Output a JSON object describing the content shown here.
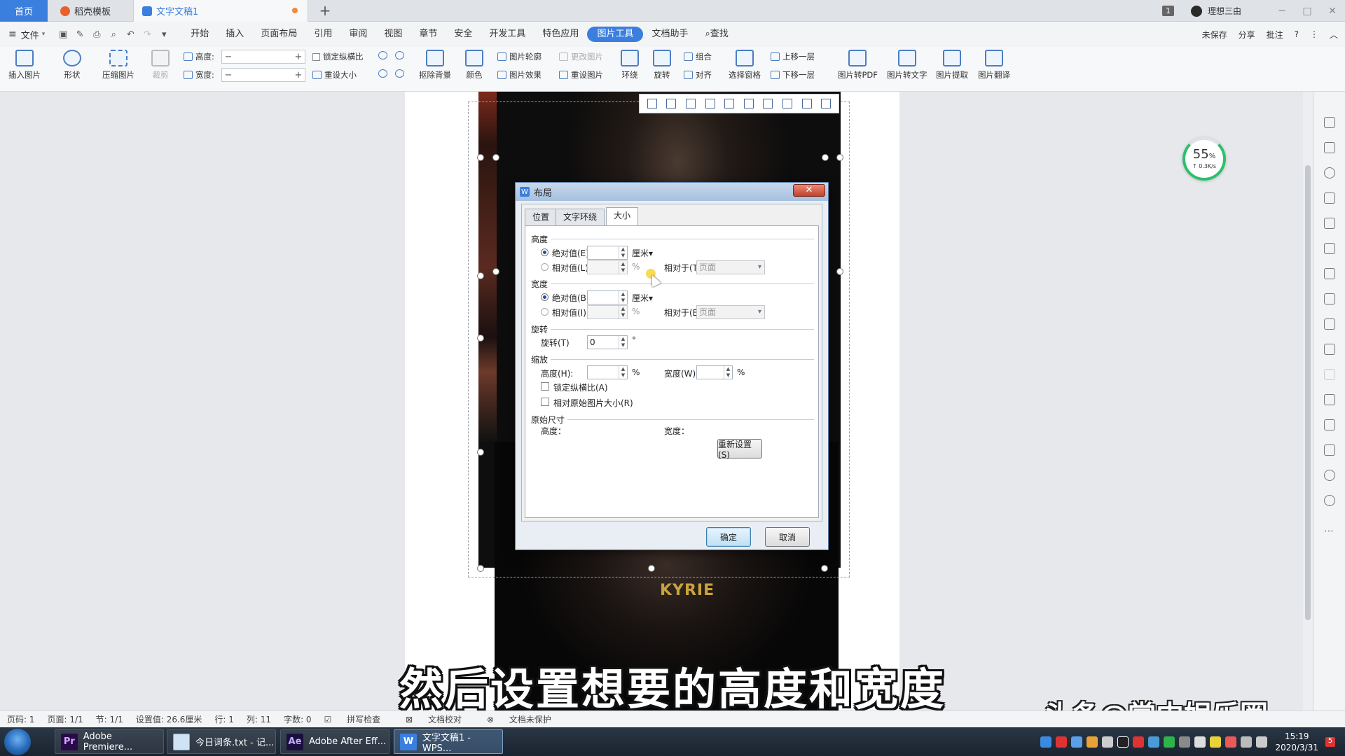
{
  "titlebar": {
    "tabs": [
      "首页",
      "稻壳模板",
      "文字文稿1"
    ],
    "add": "+",
    "badge": "1",
    "user": "理想三由",
    "window_buttons": [
      "─",
      "□",
      "✕"
    ]
  },
  "menubar": {
    "file": "文件",
    "items": [
      "开始",
      "插入",
      "页面布局",
      "引用",
      "审阅",
      "视图",
      "章节",
      "安全",
      "开发工具",
      "特色应用",
      "图片工具",
      "文档助手",
      "查找"
    ],
    "active_index": 10,
    "right": [
      "未保存",
      "分享",
      "批注",
      "?",
      "⋮",
      "︿"
    ]
  },
  "ribbon": {
    "insert_pic": "插入图片",
    "shape": "形状",
    "compress": "压缩图片",
    "crop": "裁剪",
    "height_label": "高度:",
    "width_label": "宽度:",
    "lock_ratio": "锁定纵横比",
    "reset_size": "重设大小",
    "remove_bg": "抠除背景",
    "color": "颜色",
    "pic_outline": "图片轮廓",
    "pic_effect": "图片效果",
    "change_pic": "更改图片",
    "reset_pic": "重设图片",
    "wrap": "环绕",
    "rotate": "旋转",
    "group": "组合",
    "align": "对齐",
    "select_pane": "选择窗格",
    "bring_forward": "上移一层",
    "send_backward": "下移一层",
    "to_pdf": "图片转PDF",
    "to_text": "图片转文字",
    "extract": "图片提取",
    "translate": "图片翻译",
    "minus": "−",
    "plus": "+"
  },
  "gauge": {
    "percent": "55",
    "unit": "%",
    "speed": "↑ 0.3K/s"
  },
  "photo": {
    "shirt_text": "KYRIE"
  },
  "dialog": {
    "title": "布局",
    "close": "✕",
    "tabs": [
      "位置",
      "文字环绕",
      "大小"
    ],
    "active_tab": "大小",
    "height_section": "高度",
    "abs_height": "绝对值(E)",
    "rel_height": "相对值(L)",
    "width_section": "宽度",
    "abs_width": "绝对值(B)",
    "rel_width": "相对值(I)",
    "unit_cm": "厘米▾",
    "unit_pct": "%",
    "relative_to_t": "相对于(T)",
    "relative_to_e": "相对于(E)",
    "relative_value": "页面",
    "rotate_section": "旋转",
    "rotate_label": "旋转(T)",
    "rotate_value": "0",
    "degree": "°",
    "scale_section": "缩放",
    "scale_height": "高度(H):",
    "scale_width": "宽度(W):",
    "lock_ratio": "锁定纵横比(A)",
    "relative_original": "相对原始图片大小(R)",
    "original_section": "原始尺寸",
    "orig_height": "高度：",
    "orig_width": "宽度：",
    "reset": "重新设置(S)",
    "ok": "确定",
    "cancel": "取消"
  },
  "caption": "然后设置想要的高度和宽度",
  "watermark": "头条@掌中娱乐圈",
  "statusbar": [
    "页码: 1",
    "页面: 1/1",
    "节: 1/1",
    "设置值: 26.6厘米",
    "行: 1",
    "列: 11",
    "字数: 0",
    "拼写检查",
    "文档校对",
    "文档未保护"
  ],
  "taskbar": {
    "tasks": [
      "Adobe Premiere...",
      "今日词条.txt - 记...",
      "Adobe After Eff...",
      "文字文稿1 - WPS..."
    ],
    "task_icons": [
      "Pr",
      "",
      "Ae",
      "W"
    ],
    "time": "15:19",
    "date": "2020/3/31",
    "notif": "5"
  },
  "colors": {
    "accent": "#3b7fde",
    "gauge_green": "#2cc06a",
    "premiere": "#2a0a4a",
    "after_effects": "#1a1040"
  }
}
